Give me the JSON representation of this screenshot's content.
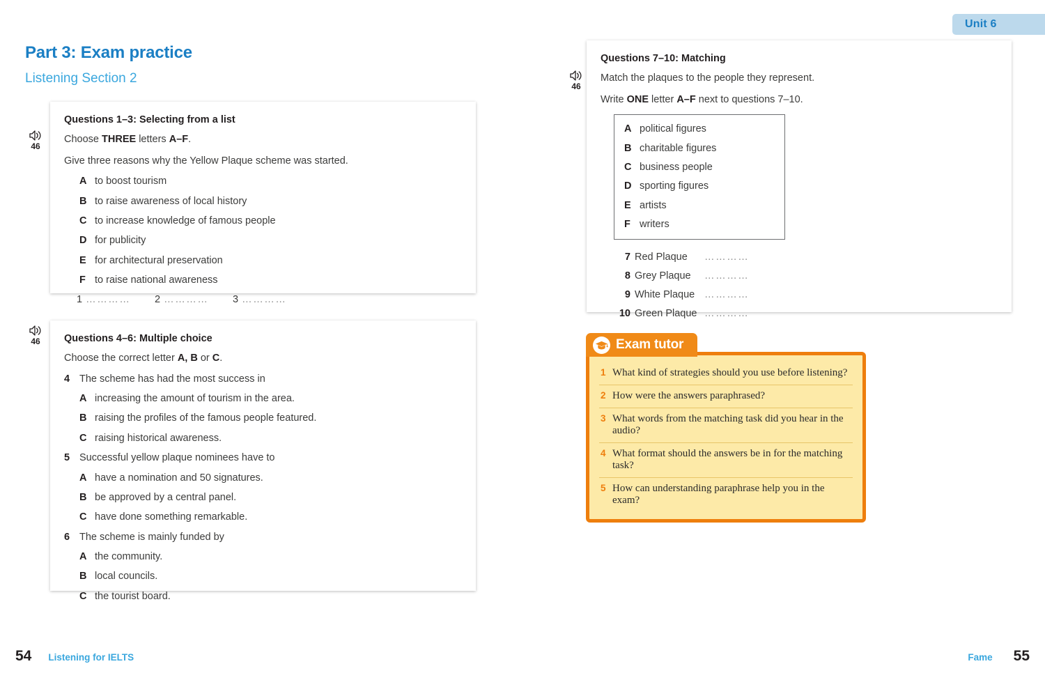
{
  "header": {
    "unit_tab_label": "Unit 6",
    "unit_tab_bg": "#bcd9ec",
    "unit_tab_color": "#1b7fc4"
  },
  "left_page": {
    "part_title": "Part 3: Exam practice",
    "section_title": "Listening Section 2",
    "card_q13": {
      "audio": {
        "icon": "speaker-icon",
        "track": "46"
      },
      "heading": "Questions 1–3: Selecting from a list",
      "instruction_prefix": "Choose ",
      "instruction_bold": "THREE",
      "instruction_mid": " letters ",
      "instruction_bold2": "A–F",
      "instruction_suffix": ".",
      "prompt": "Give three reasons why the Yellow Plaque scheme was started.",
      "options": [
        {
          "letter": "A",
          "text": "to boost tourism"
        },
        {
          "letter": "B",
          "text": "to raise awareness of local history"
        },
        {
          "letter": "C",
          "text": "to increase knowledge of famous people"
        },
        {
          "letter": "D",
          "text": "for publicity"
        },
        {
          "letter": "E",
          "text": "for architectural preservation"
        },
        {
          "letter": "F",
          "text": "to raise national awareness"
        }
      ],
      "answer_blanks": [
        {
          "num": "1",
          "dots": "…………"
        },
        {
          "num": "2",
          "dots": "…………"
        },
        {
          "num": "3",
          "dots": "…………"
        }
      ]
    },
    "card_q46": {
      "audio": {
        "icon": "speaker-icon",
        "track": "46"
      },
      "heading": "Questions 4–6: Multiple choice",
      "instruction_prefix": "Choose the correct letter ",
      "instruction_bold": "A, B",
      "instruction_mid": " or ",
      "instruction_bold2": "C",
      "instruction_suffix": ".",
      "questions": [
        {
          "num": "4",
          "stem": "The scheme has had the most success in",
          "options": [
            {
              "letter": "A",
              "text": "increasing the amount of tourism in the area."
            },
            {
              "letter": "B",
              "text": "raising the profiles of the famous people featured."
            },
            {
              "letter": "C",
              "text": "raising historical awareness."
            }
          ]
        },
        {
          "num": "5",
          "stem": "Successful yellow plaque nominees have to",
          "options": [
            {
              "letter": "A",
              "text": "have a nomination and 50 signatures."
            },
            {
              "letter": "B",
              "text": "be approved by a central panel."
            },
            {
              "letter": "C",
              "text": "have done something remarkable."
            }
          ]
        },
        {
          "num": "6",
          "stem": "The scheme is mainly funded by",
          "options": [
            {
              "letter": "A",
              "text": "the community."
            },
            {
              "letter": "B",
              "text": "local councils."
            },
            {
              "letter": "C",
              "text": "the tourist board."
            }
          ]
        }
      ]
    },
    "footer": {
      "page_number": "54",
      "running_head": "Listening for IELTS"
    }
  },
  "right_page": {
    "card_q710": {
      "audio": {
        "icon": "speaker-icon",
        "track": "46"
      },
      "heading": "Questions 7–10: Matching",
      "instruction1": "Match the plaques to the people they represent.",
      "instruction2_prefix": "Write ",
      "instruction2_bold": "ONE",
      "instruction2_mid": " letter ",
      "instruction2_bold2": "A–F",
      "instruction2_suffix": " next to questions 7–10.",
      "options": [
        {
          "letter": "A",
          "text": "political figures"
        },
        {
          "letter": "B",
          "text": "charitable figures"
        },
        {
          "letter": "C",
          "text": "business people"
        },
        {
          "letter": "D",
          "text": "sporting figures"
        },
        {
          "letter": "E",
          "text": "artists"
        },
        {
          "letter": "F",
          "text": "writers"
        }
      ],
      "match_items": [
        {
          "num": "7",
          "label": "Red Plaque",
          "dots": "…………"
        },
        {
          "num": "8",
          "label": "Grey Plaque",
          "dots": "…………"
        },
        {
          "num": "9",
          "label": "White Plaque",
          "dots": "…………"
        },
        {
          "num": "10",
          "label": "Green Plaque",
          "dots": "…………"
        }
      ]
    },
    "exam_tutor": {
      "title": "Exam tutor",
      "icon": "graduation-cap-icon",
      "accent_color": "#ee7e0d",
      "background_color": "#fdeaa8",
      "items": [
        {
          "num": "1",
          "text": "What kind of strategies should you use before listening?"
        },
        {
          "num": "2",
          "text": "How were the answers paraphrased?"
        },
        {
          "num": "3",
          "text": "What words from the matching task did you hear in the audio?"
        },
        {
          "num": "4",
          "text": "What format should the answers be in for the matching task?"
        },
        {
          "num": "5",
          "text": "How can understanding paraphrase help you in the exam?"
        }
      ]
    },
    "footer": {
      "page_number": "55",
      "running_head": "Fame"
    }
  }
}
